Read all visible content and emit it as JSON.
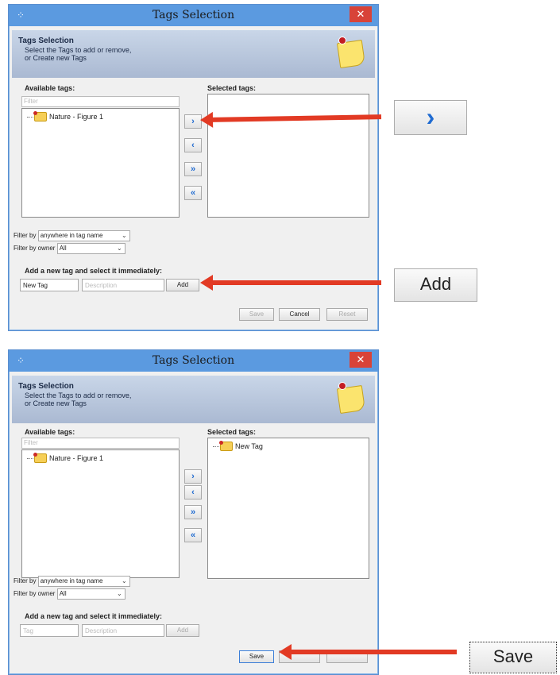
{
  "dialog1": {
    "title": "Tags Selection",
    "banner": {
      "title": "Tags Selection",
      "line1": "Select the Tags to add or remove,",
      "line2": "or Create new Tags"
    },
    "available_label": "Available tags:",
    "selected_label": "Selected tags:",
    "filter_placeholder": "Filter",
    "available_items": [
      "Nature - Figure 1"
    ],
    "selected_items": [],
    "filter_by_label": "Filter by",
    "filter_by_value": "anywhere in tag name",
    "owner_label": "Filter by owner",
    "owner_value": "All",
    "add_section_label": "Add a new tag and select it immediately:",
    "tag_input_value": "New Tag",
    "description_placeholder": "Description",
    "add_label": "Add",
    "save_label": "Save",
    "cancel_label": "Cancel",
    "reset_label": "Reset"
  },
  "dialog2": {
    "title": "Tags Selection",
    "banner": {
      "title": "Tags Selection",
      "line1": "Select the Tags to add or remove,",
      "line2": "or Create new Tags"
    },
    "available_label": "Available tags:",
    "selected_label": "Selected tags:",
    "filter_placeholder": "Filter",
    "available_items": [
      "Nature - Figure 1"
    ],
    "selected_items": [
      "New Tag"
    ],
    "filter_by_label": "Filter by",
    "filter_by_value": "anywhere in tag name",
    "owner_label": "Filter by owner",
    "owner_value": "All",
    "add_section_label": "Add a new tag and select it immediately:",
    "tag_placeholder": "Tag",
    "description_placeholder": "Description",
    "add_label": "Add",
    "save_label": "Save"
  },
  "icons": {
    "add_one": "›",
    "remove_one": "‹",
    "add_all": "»",
    "remove_all": "«",
    "close": "✕",
    "app": "⁘"
  },
  "callouts": {
    "arrow_button": "›",
    "add_button": "Add",
    "save_button": "Save"
  },
  "colors": {
    "titlebar": "#5b9ae0",
    "close": "#d84338",
    "arrow": "#e23a24",
    "arrow_icon": "#1f6bd1"
  }
}
